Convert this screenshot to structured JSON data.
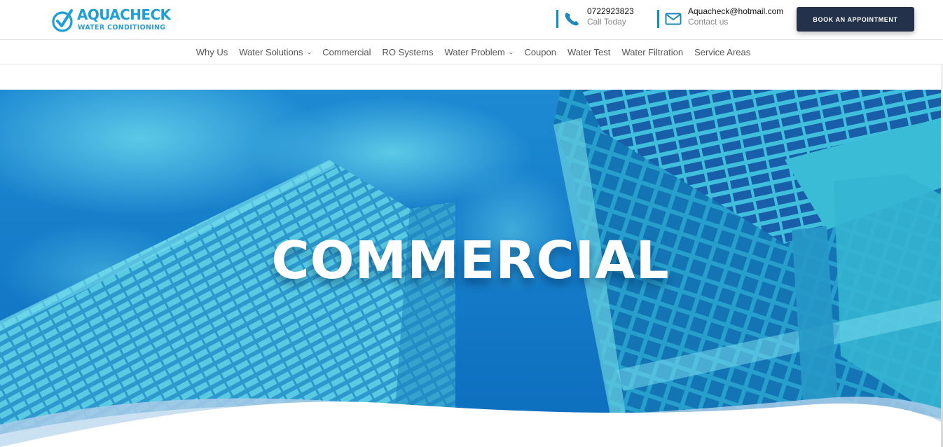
{
  "brand": {
    "name": "AQUACHECK",
    "tagline": "WATER CONDITIONING",
    "color": "#1f9fd3"
  },
  "contact": {
    "phone": {
      "icon": "phone-icon",
      "number": "0722923823",
      "caption": "Call Today"
    },
    "email": {
      "icon": "envelope-icon",
      "address": "Aquacheck@hotmail.com",
      "caption": "Contact us"
    }
  },
  "cta": {
    "label": "BOOK AN APPOINTMENT",
    "color": "#24314a"
  },
  "nav": {
    "items": [
      {
        "label": "Why Us"
      },
      {
        "label": "Water Solutions",
        "dropdown": true
      },
      {
        "label": "Commercial"
      },
      {
        "label": "RO Systems"
      },
      {
        "label": "Water Problem",
        "dropdown": true
      },
      {
        "label": "Coupon"
      },
      {
        "label": "Water Test"
      },
      {
        "label": "Water Filtration"
      },
      {
        "label": "Service Areas"
      }
    ],
    "dropdown_glyph": "v"
  },
  "hero": {
    "title": "COMMERCIAL",
    "sky_color": "#1a86cf",
    "building_color": "#3bc0d8"
  }
}
